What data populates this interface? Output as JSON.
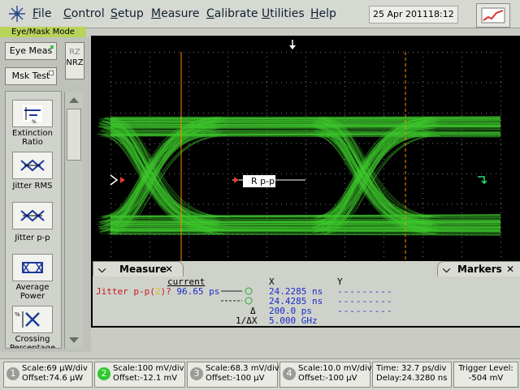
{
  "menu": {
    "items": [
      {
        "label": "File",
        "key": "F",
        "rest": "ile"
      },
      {
        "label": "Control",
        "key": "C",
        "rest": "ontrol"
      },
      {
        "label": "Setup",
        "key": "S",
        "rest": "etup"
      },
      {
        "label": "Measure",
        "key": "M",
        "rest": "easure"
      },
      {
        "label": "Calibrate",
        "key": "C",
        "rest": "alibrate"
      },
      {
        "label": "Utilities",
        "key": "U",
        "rest": "tilities"
      },
      {
        "label": "Help",
        "key": "H",
        "rest": "elp"
      }
    ],
    "date": "25 Apr 2011",
    "time": "18:12"
  },
  "left": {
    "mode_label": "Eye/Mask Mode",
    "eye_meas": "Eye Meas",
    "msk_test": "Msk Test",
    "rz": "RZ",
    "nrz": "NRZ",
    "measurements": [
      {
        "label": "Extinction Ratio",
        "icon": "extinction-ratio-icon"
      },
      {
        "label": "Jitter RMS",
        "icon": "jitter-rms-icon"
      },
      {
        "label": "Jitter p-p",
        "icon": "jitter-pp-icon"
      },
      {
        "label": "Average Power",
        "icon": "average-power-icon"
      },
      {
        "label": "Crossing Percentage",
        "icon": "crossing-percentage-icon"
      }
    ]
  },
  "screen": {
    "marker_label": "R p-p",
    "trace_color": "#3fc82f",
    "marker_color": "#ff8c00"
  },
  "measure_panel": {
    "tab_label": "Measure",
    "markers_tab": "Markers",
    "current_header": "current",
    "meas_name": "Jitter p-p(",
    "meas_channel": "2",
    "meas_suffix": ")?",
    "meas_value": "96.65 ps",
    "x_header": "X",
    "y_header": "Y",
    "x1": "24.2285 ns",
    "x2": "24.4285 ns",
    "delta_symbol": "Δ",
    "delta_value": "200.0 ps",
    "inv_delta_symbol": "1/ΔX",
    "inv_delta_value": "5.000 GHz",
    "y1": "---------",
    "y2": "---------",
    "y3": "---------"
  },
  "bottom": {
    "channels": [
      {
        "num": "1",
        "scale": "Scale:69 μW/div",
        "offset": "Offset:74.6 μW",
        "active": false
      },
      {
        "num": "2",
        "scale": "Scale:100 mV/div",
        "offset": "Offset:-12.1 mV",
        "active": true
      },
      {
        "num": "3",
        "scale": "Scale:68.3 mV/div",
        "offset": "Offset:-100 μV",
        "active": false
      },
      {
        "num": "4",
        "scale": "Scale:10.0 mV/div",
        "offset": "Offset:-100 μV",
        "active": false
      }
    ],
    "time": "Time: 32.7 ps/div",
    "delay": "Delay:24.3280 ns",
    "trigger_label": "Trigger Level:",
    "trigger_value": "-504 mV"
  }
}
